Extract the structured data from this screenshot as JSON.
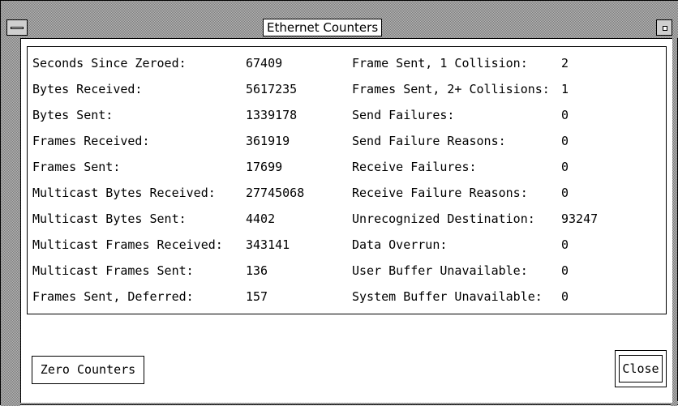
{
  "window": {
    "title": "Ethernet Counters"
  },
  "counters": {
    "left": [
      {
        "label": "Seconds Since Zeroed:",
        "value": "67409"
      },
      {
        "label": "Bytes Received:",
        "value": "5617235"
      },
      {
        "label": "Bytes Sent:",
        "value": "1339178"
      },
      {
        "label": "Frames Received:",
        "value": "361919"
      },
      {
        "label": "Frames Sent:",
        "value": "17699"
      },
      {
        "label": "Multicast Bytes Received:",
        "value": "27745068"
      },
      {
        "label": "Multicast Bytes Sent:",
        "value": "4402"
      },
      {
        "label": "Multicast Frames Received:",
        "value": "343141"
      },
      {
        "label": "Multicast Frames Sent:",
        "value": "136"
      },
      {
        "label": "Frames Sent, Deferred:",
        "value": "157"
      }
    ],
    "right": [
      {
        "label": "Frame Sent, 1 Collision:",
        "value": "2"
      },
      {
        "label": "Frames Sent, 2+ Collisions:",
        "value": "1"
      },
      {
        "label": "Send Failures:",
        "value": "0"
      },
      {
        "label": "Send Failure Reasons:",
        "value": "0"
      },
      {
        "label": "Receive Failures:",
        "value": "0"
      },
      {
        "label": "Receive Failure Reasons:",
        "value": "0"
      },
      {
        "label": "Unrecognized Destination:",
        "value": "93247"
      },
      {
        "label": "Data Overrun:",
        "value": "0"
      },
      {
        "label": "User Buffer Unavailable:",
        "value": "0"
      },
      {
        "label": "System Buffer Unavailable:",
        "value": "0"
      }
    ]
  },
  "buttons": {
    "zero_label": "Zero Counters",
    "close_label": "Close"
  }
}
